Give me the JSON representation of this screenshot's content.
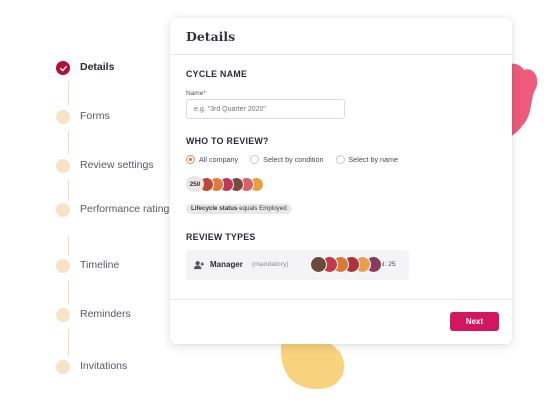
{
  "stepper": {
    "steps": [
      {
        "label": "Details",
        "state": "done"
      },
      {
        "label": "Forms",
        "state": "todo"
      },
      {
        "label": "Review settings",
        "state": "todo"
      },
      {
        "label": "Performance rating",
        "state": "todo"
      },
      {
        "label": "Timeline",
        "state": "todo"
      },
      {
        "label": "Reminders",
        "state": "todo"
      },
      {
        "label": "Invitations",
        "state": "todo"
      }
    ]
  },
  "card": {
    "title": "Details",
    "cycle_section": "CYCLE NAME",
    "name_label": "Name*",
    "name_placeholder": "e.g. \"3rd Quarter 2020\"",
    "name_value": "",
    "who_section": "WHO TO REVIEW?",
    "options": [
      "All company",
      "Select by condition",
      "Select by name"
    ],
    "selected_option": "All company",
    "people_count": "250",
    "filter_chip": {
      "field": "Lifecycle status",
      "rest": "equals Employed"
    },
    "types_section": "REVIEW TYPES",
    "review_type": {
      "name": "Manager",
      "note": "(mandatory)",
      "total": "Total: 25"
    },
    "next_label": "Next"
  },
  "colors": {
    "accent": "#d4155f",
    "step_done": "#b0103a",
    "step_todo": "#f8e3c6",
    "blob_pink": "#ee5a7c",
    "blob_yellow": "#f9d27e"
  },
  "icons": {
    "done_step": "checkmark-icon",
    "review_type": "people-icon"
  }
}
